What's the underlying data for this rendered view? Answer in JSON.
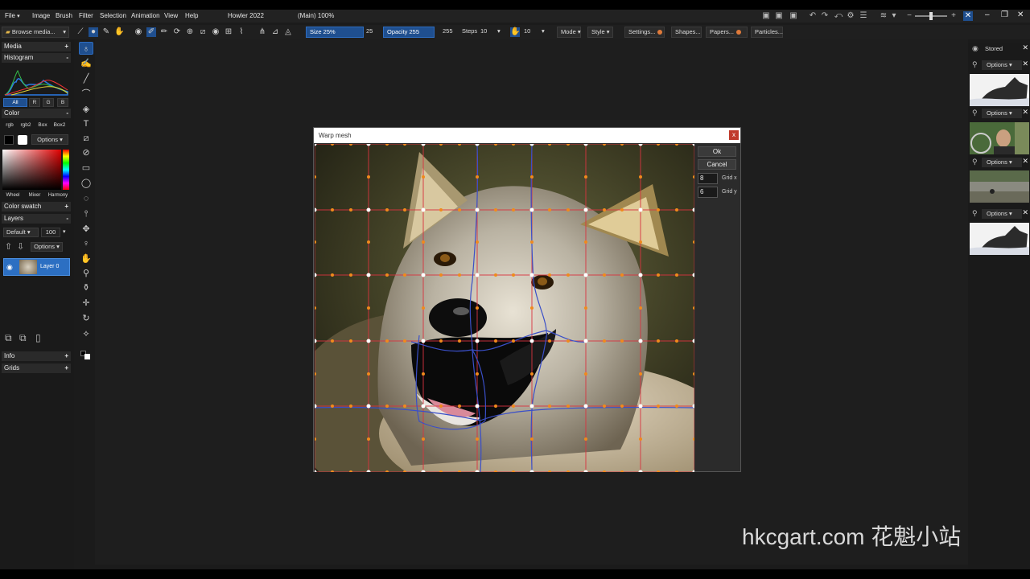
{
  "menubar": {
    "file": "File",
    "image": "Image",
    "brush": "Brush",
    "filter": "Filter",
    "selection": "Selection",
    "animation": "Animation",
    "view": "View",
    "help": "Help",
    "app_title": "Howler 2022",
    "doc_title": "(Main)  100%"
  },
  "toolbar": {
    "size_label": "Size 25%",
    "size_value": "25",
    "opacity_label": "Opacity 255",
    "opacity_value": "255",
    "steps_label": "Steps",
    "steps_value": "10",
    "spacing_value": "10",
    "mode": "Mode",
    "style": "Style",
    "settings": "Settings...",
    "shapes": "Shapes...",
    "papers": "Papers...",
    "particles": "Particles..."
  },
  "left_panel": {
    "browse_media": "Browse media...",
    "media": "Media",
    "histogram": "Histogram",
    "hist_channels": [
      "All",
      "R",
      "G",
      "B"
    ],
    "color": "Color",
    "color_modes": [
      "rgb",
      "rgb2",
      "Box",
      "Box2"
    ],
    "options": "Options",
    "picker_tabs": [
      "Wheel",
      "Mixer",
      "Harmony"
    ],
    "color_swatch": "Color swatch",
    "layers": "Layers",
    "blend_mode": "Default",
    "layer_opacity": "100",
    "layer_options": "Options",
    "layer_name": "Layer 0",
    "info": "Info",
    "grids": "Grids"
  },
  "dialog": {
    "title": "Warp mesh",
    "ok": "Ok",
    "cancel": "Cancel",
    "grid_x_value": "8",
    "grid_x_label": "Grid x",
    "grid_y_value": "6",
    "grid_y_label": "Grid y"
  },
  "right_panel": {
    "stored": "Stored",
    "options": "Options",
    "thumbnails": [
      "wolf-thumbnail",
      "portrait-thumbnail",
      "landscape-thumbnail",
      "wolf-thumbnail"
    ]
  },
  "watermark": "hkcgart.com  花魁小站",
  "colors": {
    "accent": "#1f4f8f",
    "mesh_red": "#d9333f",
    "mesh_blue": "#3a4fc8",
    "mesh_orange": "#f08a1c",
    "close_red": "#c0392b"
  }
}
